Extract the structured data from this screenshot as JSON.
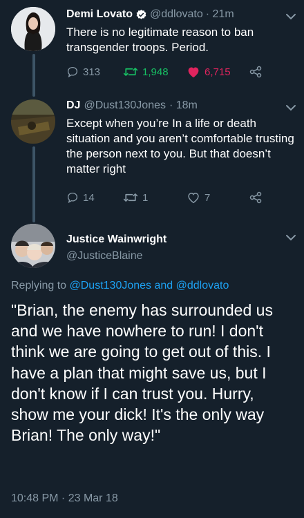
{
  "tweets": [
    {
      "name": "Demi Lovato",
      "handle": "@ddlovato",
      "time": "· 21m",
      "text": "There is no legitimate reason to ban transgender troops. Period.",
      "replies": "313",
      "retweets": "1,948",
      "likes": "6,715",
      "liked": true
    },
    {
      "name": "DJ",
      "handle": "@Dust130Jones",
      "time": "· 18m",
      "text": "Except when you’re In a life or death situation and you aren’t comfortable trusting the person next to you. But that doesn’t matter right",
      "replies": "14",
      "retweets": "1",
      "likes": "7"
    }
  ],
  "main": {
    "name": "Justice Wainwright",
    "handle": "@JusticeBlaine",
    "replying_prefix": "Replying to",
    "replying_user1": "@Dust130Jones",
    "replying_and": "and",
    "replying_user2": "@ddlovato",
    "text": "\"Brian, the enemy has surrounded us and we have nowhere to run! I don't think we are going to get out of this. I have a plan that might save us, but I don't know if I can trust you. Hurry, show me your dick! It's the only way Brian! The only way!\"",
    "timestamp": "10:48 PM · 23 Mar 18"
  },
  "colors": {
    "background": "#15202b",
    "muted": "#8899a6",
    "link": "#1da1f2",
    "like_active": "#e0245e",
    "retweet_active": "#17bf63",
    "verified": "#ffffff"
  },
  "icons": [
    "reply-icon",
    "retweet-icon",
    "like-icon",
    "share-icon",
    "verified-badge-icon",
    "chevron-down-icon"
  ]
}
